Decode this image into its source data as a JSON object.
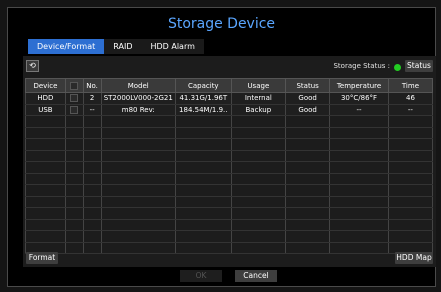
{
  "title": "Storage Device",
  "tabs": [
    {
      "label": "Device/Format",
      "active": true
    },
    {
      "label": "RAID",
      "active": false
    },
    {
      "label": "HDD Alarm",
      "active": false
    }
  ],
  "storage_status_label": "Storage Status :",
  "status_button": "Status",
  "columns": [
    "Device",
    "",
    "No.",
    "Model",
    "Capacity",
    "Usage",
    "Status",
    "Temperature",
    "Time"
  ],
  "rows": [
    [
      "HDD",
      "",
      "2",
      "ST2000LV000-2G21",
      "41.31G/1.96T",
      "Internal",
      "Good",
      "30°C/86°F",
      "46"
    ],
    [
      "USB",
      "",
      "--",
      "m80 Rev:",
      "184.54M/1.9..",
      "Backup",
      "Good",
      "--",
      "--"
    ]
  ],
  "format_button": "Format",
  "hddmap_button": "HDD Map",
  "ok_button": "OK",
  "cancel_button": "Cancel",
  "colors": {
    "accent": "#2d6fd2",
    "title": "#5aa6ff",
    "status_ok": "#22cc22"
  }
}
